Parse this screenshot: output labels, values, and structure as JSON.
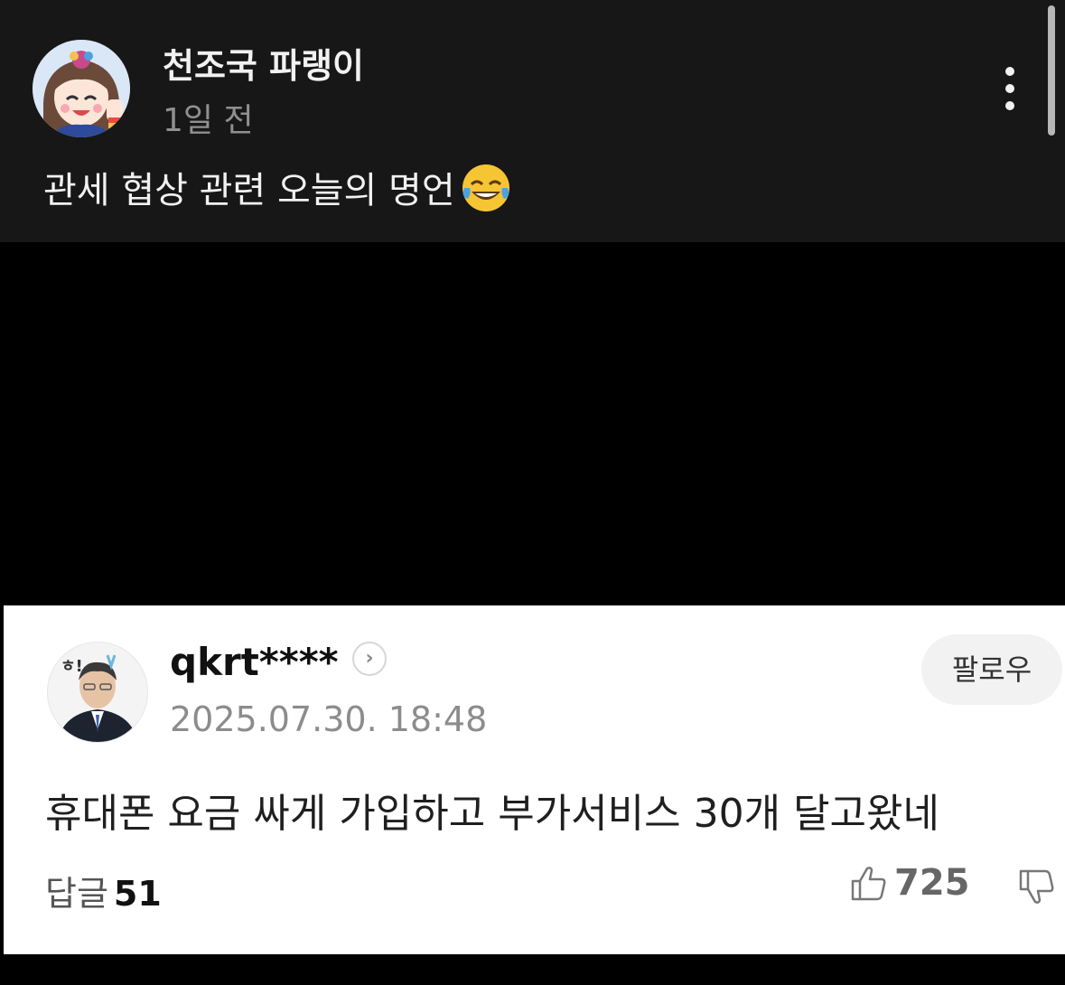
{
  "post": {
    "author": "천조국 파랭이",
    "time": "1일 전",
    "text": "관세 협상 관련 오늘의 명언",
    "emoji_icon": "face-with-tears-of-joy-icon"
  },
  "comment": {
    "username": "qkrt****",
    "date": "2025.07.30. 18:48",
    "follow_label": "팔로우",
    "text": "휴대폰 요금 싸게 가입하고 부가서비스 30개 달고왔네",
    "replies_label": "답글",
    "replies_count": "51",
    "likes": "725",
    "avatar_tag": "ㅎ!"
  }
}
